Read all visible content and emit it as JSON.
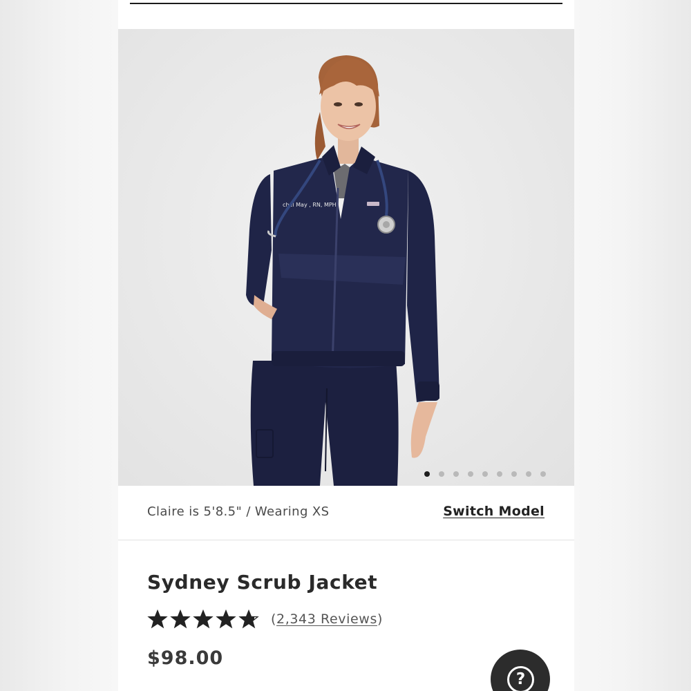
{
  "gallery": {
    "image_alt": "Model wearing navy Sydney Scrub Jacket with stethoscope",
    "embroidery": "chel May  , RN, MPH",
    "slide_count": 9,
    "active_slide": 1
  },
  "model": {
    "info": "Claire is 5'8.5\" / Wearing XS",
    "switch_label": "Switch Model"
  },
  "product": {
    "title": "Sydney Scrub Jacket",
    "rating": 4.8,
    "rating_max": 5,
    "reviews_open": "(",
    "reviews_label": "2,343 Reviews",
    "reviews_close": ")",
    "price": "$98.00"
  },
  "help": {
    "icon_glyph": "?",
    "icon": "question-icon"
  },
  "colors": {
    "navy": "#1f2447",
    "star": "#222222",
    "help_bg": "#2c2c2c",
    "dot_active": "#1e1e1e",
    "dot_inactive": "#b9b9b9"
  }
}
